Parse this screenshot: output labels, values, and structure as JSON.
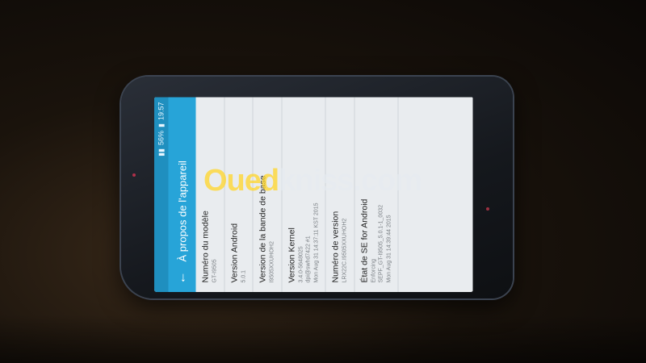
{
  "status_bar": {
    "signal_text": "56%",
    "time": "19:57"
  },
  "app_bar": {
    "back_icon": "arrow-left-icon",
    "title": "À propos de l'appareil"
  },
  "items": [
    {
      "label": "Numéro du modèle",
      "values": [
        "GT-I9505"
      ]
    },
    {
      "label": "Version Android",
      "values": [
        "5.0.1"
      ]
    },
    {
      "label": "Version de la bande de base",
      "values": [
        "I9505XXUHOH2"
      ]
    },
    {
      "label": "Version Kernel",
      "values": [
        "3.4.0-5648025",
        "dpi@swhd7422 #1",
        "Mon Aug 31 14:37:11 KST 2015"
      ]
    },
    {
      "label": "Numéro de version",
      "values": [
        "LRX22C.I9505XXUHOH2"
      ]
    },
    {
      "label": "État de SE for Android",
      "values": [
        "Enforcing",
        "SEPF_GT-I9505_5.0.1-1_0032",
        "Mon Aug 31 14:39:44 2015"
      ]
    }
  ],
  "watermark": {
    "part1": "Oued",
    "part2": "kniss.com"
  }
}
